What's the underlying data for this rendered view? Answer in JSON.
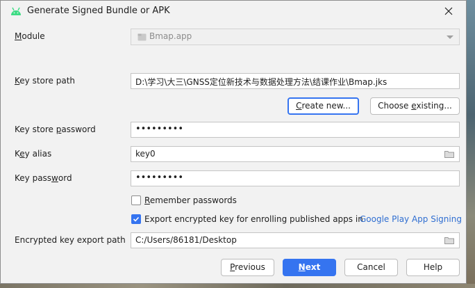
{
  "window": {
    "title": "Generate Signed Bundle or APK",
    "app_icon": "android-icon",
    "close_icon": "close-icon"
  },
  "module": {
    "label_mnemonic": "M",
    "label_rest": "odule",
    "value": "Bmap.app",
    "icon": "module-folder-icon"
  },
  "keystore": {
    "path_label_mnemonic": "K",
    "path_label_rest": "ey store path",
    "path_value": "D:\\学习\\大三\\GNSS定位新技术与数据处理方法\\结课作业\\Bmap.jks",
    "create_new_mnemonic": "C",
    "create_new_rest": "reate new...",
    "choose_existing_pre": "Choose ",
    "choose_existing_mnemonic": "e",
    "choose_existing_rest": "xisting...",
    "password_label_pre": "Key store ",
    "password_label_mnemonic": "p",
    "password_label_rest": "assword",
    "password_value": "•••••••••"
  },
  "key": {
    "alias_label_pre": "K",
    "alias_label_mnemonic": "e",
    "alias_label_rest": "y alias",
    "alias_value": "key0",
    "password_label_pre": "Key pass",
    "password_label_mnemonic": "w",
    "password_label_rest": "ord",
    "password_value": "•••••••••"
  },
  "options": {
    "remember_mnemonic": "R",
    "remember_rest": "emember passwords",
    "remember_checked": false,
    "export_label": "Export encrypted key for enrolling published apps in",
    "export_link": "Google Play App Signing",
    "export_checked": true
  },
  "export_path": {
    "label": "Encrypted key export path",
    "value": "C:/Users/86181/Desktop"
  },
  "buttons": {
    "previous_mnemonic": "P",
    "previous_rest": "revious",
    "next_mnemonic": "N",
    "next_rest": "ext",
    "cancel": "Cancel",
    "help": "Help"
  },
  "colors": {
    "accent": "#3574f0",
    "link": "#2f6ed1",
    "dialog_bg": "#f2f2f2"
  }
}
